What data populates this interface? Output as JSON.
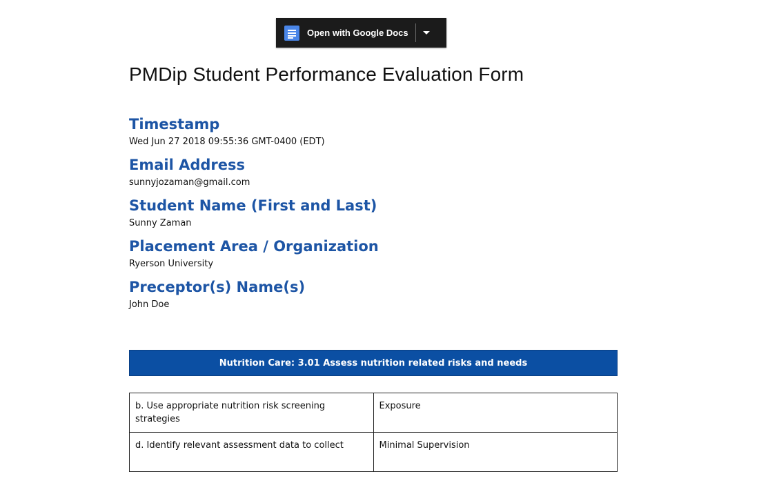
{
  "toolbar": {
    "open_with_label": "Open with Google Docs",
    "app_icon": "google-docs-icon",
    "dropdown_icon": "caret-down-icon"
  },
  "document": {
    "title": "PMDip Student Performance Evaluation Form",
    "fields": [
      {
        "label": "Timestamp",
        "value": "Wed Jun 27 2018 09:55:36 GMT-0400 (EDT)"
      },
      {
        "label": "Email Address",
        "value": "sunnyjozaman@gmail.com"
      },
      {
        "label": "Student Name (First and Last)",
        "value": "Sunny Zaman"
      },
      {
        "label": "Placement Area / Organization",
        "value": "Ryerson University"
      },
      {
        "label": "Preceptor(s) Name(s)",
        "value": "John Doe"
      }
    ],
    "section_heading": "Nutrition Care: 3.01 Assess nutrition related risks and needs",
    "rows": [
      {
        "skill": "b. Use appropriate nutrition risk screening strategies",
        "level": "Exposure"
      },
      {
        "skill": "d. Identify relevant assessment data to collect",
        "level": "Minimal Supervision"
      }
    ]
  },
  "colors": {
    "heading_blue": "#1d55a5",
    "banner_blue": "#0b4fa3",
    "toolbar_bg": "#1b1b1b",
    "docs_icon_blue": "#4a86e8"
  }
}
